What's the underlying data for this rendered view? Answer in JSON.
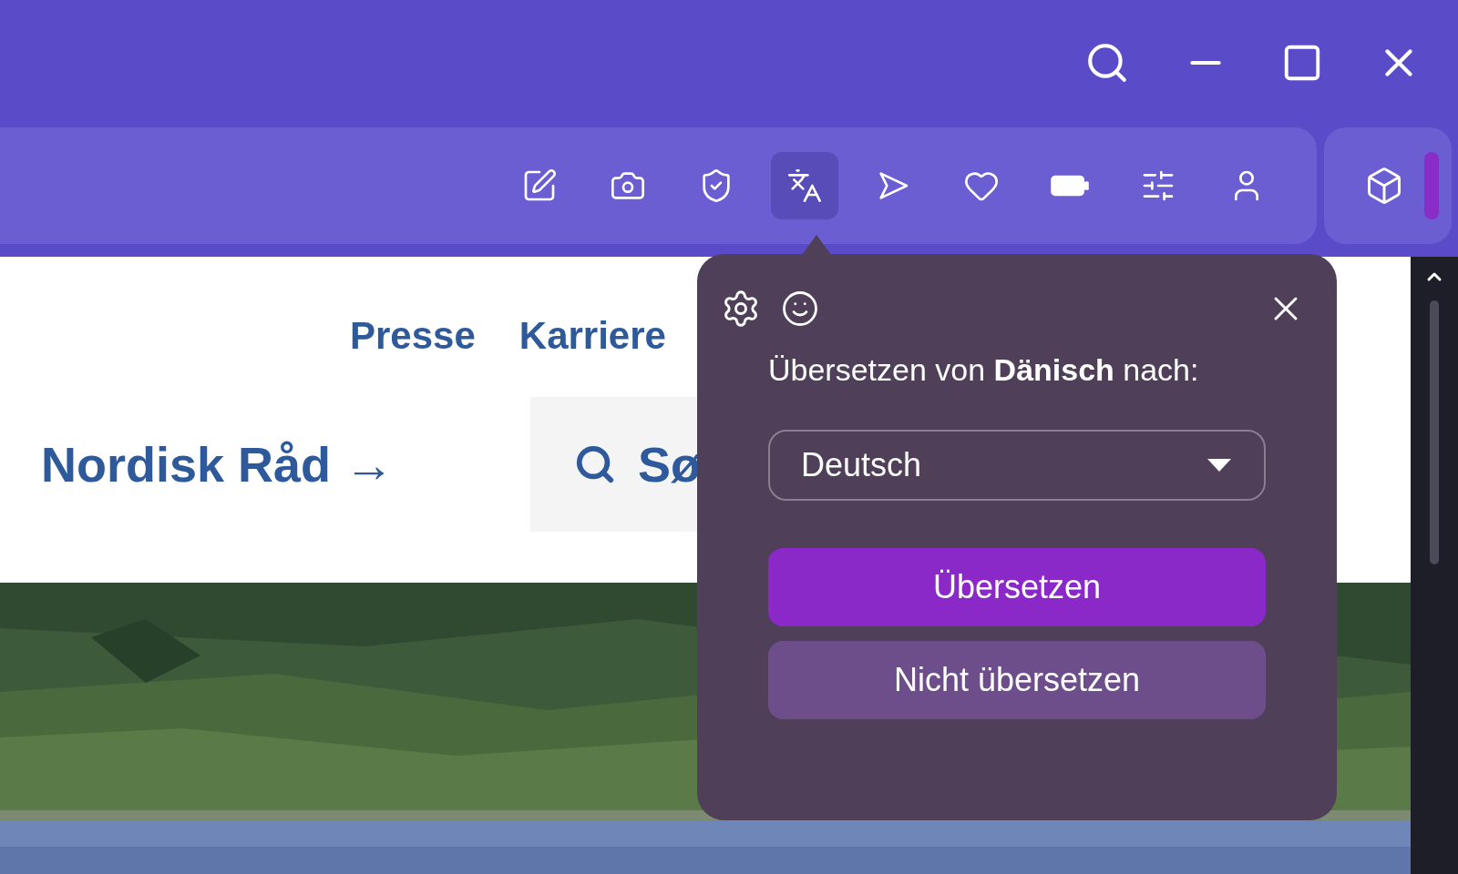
{
  "toolbar": {
    "items": [
      {
        "kind": "note",
        "selected": false
      },
      {
        "kind": "camera",
        "selected": false
      },
      {
        "kind": "shield",
        "selected": false
      },
      {
        "kind": "translate",
        "selected": true
      },
      {
        "kind": "send",
        "selected": false
      },
      {
        "kind": "heart",
        "selected": false
      },
      {
        "kind": "battery",
        "selected": false
      },
      {
        "kind": "sliders",
        "selected": false
      },
      {
        "kind": "user",
        "selected": false
      }
    ]
  },
  "page": {
    "nav_links": [
      "Presse",
      "Karriere"
    ],
    "title_link": "Nordisk Råd →",
    "search": {
      "value": "Sø"
    }
  },
  "popup": {
    "prompt": "Übersetzen von **Dänisch** nach:",
    "language": "Deutsch",
    "buttons": [
      {
        "label": "Übersetzen",
        "kind": "primary"
      },
      {
        "label": "Nicht übersetzen",
        "kind": "secondary"
      }
    ]
  }
}
